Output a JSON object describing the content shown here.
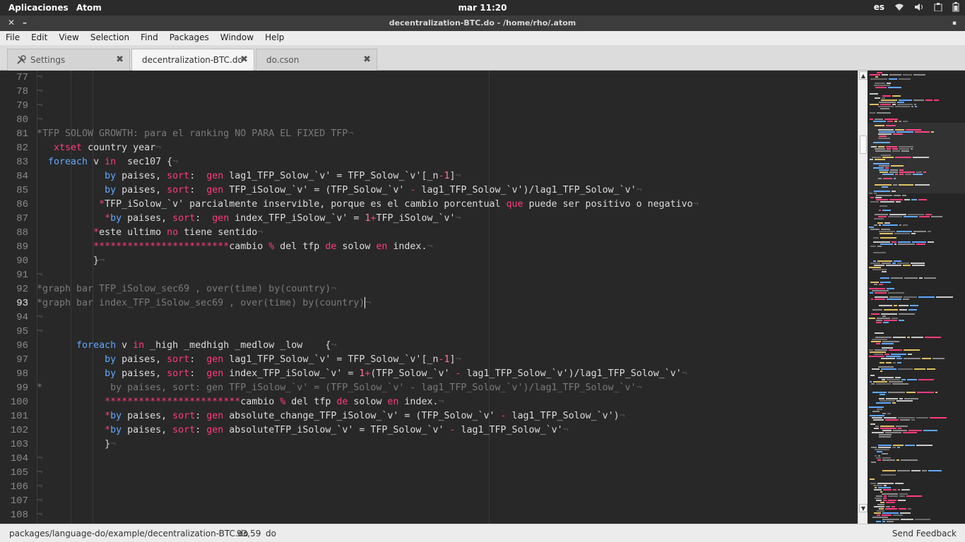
{
  "system_bar": {
    "apps_label": "Aplicaciones",
    "app_name": "Atom",
    "clock": "mar 11:20",
    "language": "es"
  },
  "window": {
    "title": "decentralization-BTC.do - /home/rho/.atom"
  },
  "menu": [
    "File",
    "Edit",
    "View",
    "Selection",
    "Find",
    "Packages",
    "Window",
    "Help"
  ],
  "tabs": [
    {
      "label": "Settings",
      "icon": "tools-icon",
      "active": false
    },
    {
      "label": "decentralization-BTC.do",
      "active": true
    },
    {
      "label": "do.cson",
      "active": false
    }
  ],
  "editor": {
    "current_line": 93,
    "lines": [
      {
        "n": "77",
        "indent": 0,
        "spans": []
      },
      {
        "n": "78",
        "indent": 0,
        "spans": []
      },
      {
        "n": "79",
        "indent": 0,
        "spans": []
      },
      {
        "n": "80",
        "indent": 0,
        "spans": []
      },
      {
        "n": "81",
        "indent": 0,
        "spans": [
          {
            "c": "cm",
            "t": "*TFP SOLOW GROWTH: para el ranking NO PARA EL FIXED TFP"
          }
        ]
      },
      {
        "n": "82",
        "indent": 0,
        "spans": [
          {
            "c": "",
            "t": "   "
          },
          {
            "c": "kp",
            "t": "xtset"
          },
          {
            "c": "",
            "t": " country year"
          }
        ]
      },
      {
        "n": "83",
        "indent": 0,
        "spans": [
          {
            "c": "",
            "t": "  "
          },
          {
            "c": "kw",
            "t": "foreach"
          },
          {
            "c": "",
            "t": " v "
          },
          {
            "c": "kp",
            "t": "in"
          },
          {
            "c": "",
            "t": "  sec107 {"
          }
        ]
      },
      {
        "n": "84",
        "indent": 0,
        "spans": [
          {
            "c": "",
            "t": "            "
          },
          {
            "c": "kw",
            "t": "by"
          },
          {
            "c": "",
            "t": " paises, "
          },
          {
            "c": "kp",
            "t": "sort"
          },
          {
            "c": "",
            "t": ":  "
          },
          {
            "c": "kp",
            "t": "gen"
          },
          {
            "c": "",
            "t": " lag1_TFP_Solow_`v' = TFP_Solow_`v'[_n"
          },
          {
            "c": "kp",
            "t": "-"
          },
          {
            "c": "num",
            "t": "1"
          },
          {
            "c": "",
            "t": "]"
          }
        ]
      },
      {
        "n": "85",
        "indent": 0,
        "spans": [
          {
            "c": "",
            "t": "            "
          },
          {
            "c": "kw",
            "t": "by"
          },
          {
            "c": "",
            "t": " paises, "
          },
          {
            "c": "kp",
            "t": "sort"
          },
          {
            "c": "",
            "t": ":  "
          },
          {
            "c": "kp",
            "t": "gen"
          },
          {
            "c": "",
            "t": " TFP_iSolow_`v' = (TFP_Solow_`v' "
          },
          {
            "c": "kp",
            "t": "-"
          },
          {
            "c": "",
            "t": " lag1_TFP_Solow_`v')/lag1_TFP_Solow_`v'"
          }
        ]
      },
      {
        "n": "86",
        "indent": 0,
        "spans": [
          {
            "c": "",
            "t": "           "
          },
          {
            "c": "kp",
            "t": "*"
          },
          {
            "c": "",
            "t": "TFP_iSolow_`v' parcialmente inservible, porque es el cambio porcentual "
          },
          {
            "c": "kp",
            "t": "que"
          },
          {
            "c": "",
            "t": " puede ser positivo o negativo"
          }
        ]
      },
      {
        "n": "87",
        "indent": 0,
        "spans": [
          {
            "c": "",
            "t": "            "
          },
          {
            "c": "kp",
            "t": "*"
          },
          {
            "c": "kw",
            "t": "by"
          },
          {
            "c": "",
            "t": " paises, "
          },
          {
            "c": "kp",
            "t": "sort"
          },
          {
            "c": "",
            "t": ":  "
          },
          {
            "c": "kp",
            "t": "gen"
          },
          {
            "c": "",
            "t": " index_TFP_iSolow_`v' = "
          },
          {
            "c": "num",
            "t": "1"
          },
          {
            "c": "kp",
            "t": "+"
          },
          {
            "c": "",
            "t": "TFP_iSolow_`v'"
          }
        ]
      },
      {
        "n": "88",
        "indent": 0,
        "spans": [
          {
            "c": "",
            "t": "          "
          },
          {
            "c": "kp",
            "t": "*"
          },
          {
            "c": "",
            "t": "este ultimo "
          },
          {
            "c": "kp",
            "t": "no"
          },
          {
            "c": "",
            "t": " tiene sentido"
          }
        ]
      },
      {
        "n": "89",
        "indent": 0,
        "spans": [
          {
            "c": "",
            "t": "          "
          },
          {
            "c": "kp",
            "t": "************************"
          },
          {
            "c": "",
            "t": "cambio "
          },
          {
            "c": "kp",
            "t": "%"
          },
          {
            "c": "",
            "t": " del tfp "
          },
          {
            "c": "kp",
            "t": "de"
          },
          {
            "c": "",
            "t": " solow "
          },
          {
            "c": "kp",
            "t": "en"
          },
          {
            "c": "",
            "t": " index."
          }
        ]
      },
      {
        "n": "90",
        "indent": 0,
        "spans": [
          {
            "c": "",
            "t": "          }"
          }
        ]
      },
      {
        "n": "91",
        "indent": 0,
        "spans": []
      },
      {
        "n": "92",
        "indent": 0,
        "spans": [
          {
            "c": "cm",
            "t": "*graph bar TFP_iSolow_sec69 , over(time) by(country)"
          }
        ]
      },
      {
        "n": "93",
        "indent": 0,
        "spans": [
          {
            "c": "cm",
            "t": "*graph bar index_TFP_iSolow_sec69 , over(time) by(country)"
          }
        ],
        "cursor": true
      },
      {
        "n": "94",
        "indent": 0,
        "spans": []
      },
      {
        "n": "95",
        "indent": 0,
        "spans": []
      },
      {
        "n": "96",
        "indent": 0,
        "spans": [
          {
            "c": "",
            "t": "       "
          },
          {
            "c": "kw",
            "t": "foreach"
          },
          {
            "c": "",
            "t": " v "
          },
          {
            "c": "kp",
            "t": "in"
          },
          {
            "c": "",
            "t": " _high _medhigh _medlow _low    {"
          }
        ]
      },
      {
        "n": "97",
        "indent": 0,
        "spans": [
          {
            "c": "",
            "t": "            "
          },
          {
            "c": "kw",
            "t": "by"
          },
          {
            "c": "",
            "t": " paises, "
          },
          {
            "c": "kp",
            "t": "sort"
          },
          {
            "c": "",
            "t": ":  "
          },
          {
            "c": "kp",
            "t": "gen"
          },
          {
            "c": "",
            "t": " lag1_TFP_Solow_`v' = TFP_Solow_`v'[_n"
          },
          {
            "c": "kp",
            "t": "-"
          },
          {
            "c": "num",
            "t": "1"
          },
          {
            "c": "",
            "t": "]"
          }
        ]
      },
      {
        "n": "98",
        "indent": 0,
        "spans": [
          {
            "c": "",
            "t": "            "
          },
          {
            "c": "kw",
            "t": "by"
          },
          {
            "c": "",
            "t": " paises, "
          },
          {
            "c": "kp",
            "t": "sort"
          },
          {
            "c": "",
            "t": ":  "
          },
          {
            "c": "kp",
            "t": "gen"
          },
          {
            "c": "",
            "t": " index_TFP_iSolow_`v' = "
          },
          {
            "c": "num",
            "t": "1"
          },
          {
            "c": "kp",
            "t": "+"
          },
          {
            "c": "",
            "t": "(TFP_Solow_`v' "
          },
          {
            "c": "kp",
            "t": "-"
          },
          {
            "c": "",
            "t": " lag1_TFP_Solow_`v')/lag1_TFP_Solow_`v'"
          }
        ]
      },
      {
        "n": "99",
        "indent": 0,
        "spans": [
          {
            "c": "cm",
            "t": "*            by paises, sort: gen TFP_iSolow_`v' = (TFP_Solow_`v' - lag1_TFP_Solow_`v')/lag1_TFP_Solow_`v'"
          }
        ]
      },
      {
        "n": "100",
        "indent": 0,
        "spans": [
          {
            "c": "",
            "t": "            "
          },
          {
            "c": "kp",
            "t": "************************"
          },
          {
            "c": "",
            "t": "cambio "
          },
          {
            "c": "kp",
            "t": "%"
          },
          {
            "c": "",
            "t": " del tfp "
          },
          {
            "c": "kp",
            "t": "de"
          },
          {
            "c": "",
            "t": " solow "
          },
          {
            "c": "kp",
            "t": "en"
          },
          {
            "c": "",
            "t": " index."
          }
        ]
      },
      {
        "n": "101",
        "indent": 0,
        "spans": [
          {
            "c": "",
            "t": "            "
          },
          {
            "c": "kp",
            "t": "*"
          },
          {
            "c": "kw",
            "t": "by"
          },
          {
            "c": "",
            "t": " paises, "
          },
          {
            "c": "kp",
            "t": "sort"
          },
          {
            "c": "",
            "t": ": "
          },
          {
            "c": "kp",
            "t": "gen"
          },
          {
            "c": "",
            "t": " absolute_change_TFP_iSolow_`v' = (TFP_Solow_`v' "
          },
          {
            "c": "kp",
            "t": "-"
          },
          {
            "c": "",
            "t": " lag1_TFP_Solow_`v')"
          }
        ]
      },
      {
        "n": "102",
        "indent": 0,
        "spans": [
          {
            "c": "",
            "t": "            "
          },
          {
            "c": "kp",
            "t": "*"
          },
          {
            "c": "kw",
            "t": "by"
          },
          {
            "c": "",
            "t": " paises, "
          },
          {
            "c": "kp",
            "t": "sort"
          },
          {
            "c": "",
            "t": ": "
          },
          {
            "c": "kp",
            "t": "gen"
          },
          {
            "c": "",
            "t": " absoluteTFP_iSolow_`v' = TFP_Solow_`v' "
          },
          {
            "c": "kp",
            "t": "-"
          },
          {
            "c": "",
            "t": " lag1_TFP_Solow_`v'"
          }
        ]
      },
      {
        "n": "103",
        "indent": 0,
        "spans": [
          {
            "c": "",
            "t": "            }"
          }
        ]
      },
      {
        "n": "104",
        "indent": 0,
        "spans": []
      },
      {
        "n": "105",
        "indent": 0,
        "spans": []
      },
      {
        "n": "106",
        "indent": 0,
        "spans": []
      },
      {
        "n": "107",
        "indent": 0,
        "spans": []
      },
      {
        "n": "108",
        "indent": 0,
        "spans": []
      }
    ]
  },
  "status": {
    "path": "packages/language-do/example/decentralization-BTC.do",
    "position": "93,59",
    "grammar": "do",
    "feedback": "Send Feedback"
  },
  "colors": {
    "keyword": "#5fa8ff",
    "operator": "#ff3b7e",
    "comment": "#7a7a7a",
    "background": "#282828"
  }
}
